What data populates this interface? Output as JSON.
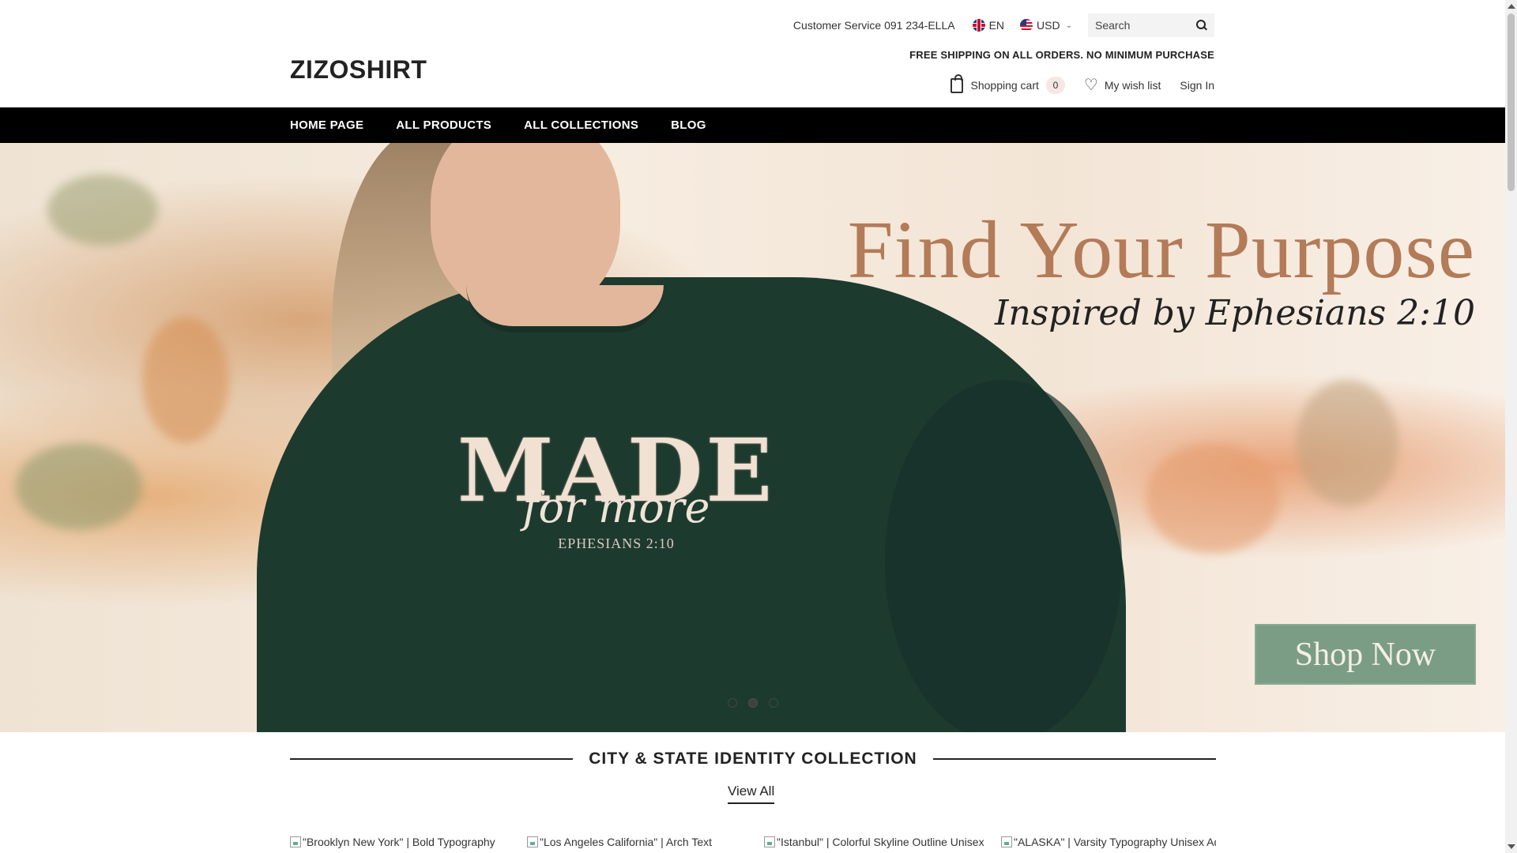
{
  "header": {
    "customer_service": "Customer Service 091 234-ELLA",
    "language": "EN",
    "currency": "USD",
    "search_placeholder": "Search",
    "promo": "FREE SHIPPING ON ALL ORDERS. NO MINIMUM PURCHASE",
    "logo": "ZIZOSHIRT",
    "cart_label": "Shopping cart",
    "cart_count": "0",
    "wishlist_label": "My wish list",
    "signin_label": "Sign In"
  },
  "nav": {
    "items": [
      {
        "label": "HOME PAGE"
      },
      {
        "label": "ALL PRODUCTS"
      },
      {
        "label": "ALL COLLECTIONS"
      },
      {
        "label": "BLOG"
      }
    ]
  },
  "hero": {
    "title": "Find Your Purpose",
    "subtitle": "Inspired by Ephesians 2:10",
    "shirt_print_main": "MADE",
    "shirt_print_script": "for more",
    "shirt_print_ref": "EPHESIANS 2:10",
    "cta_label": "Shop Now",
    "slides_total": 3,
    "active_slide": 2
  },
  "collection": {
    "title": "CITY & STATE IDENTITY COLLECTION",
    "view_all": "View All",
    "products": [
      {
        "alt": "\"Brooklyn New York\" | Bold Typography"
      },
      {
        "alt": "\"Los Angeles California\" | Arch Text"
      },
      {
        "alt": "\"Istanbul\" | Colorful Skyline Outline Unisex"
      },
      {
        "alt": "\"ALASKA\" | Varsity Typography Unisex Adult"
      }
    ]
  },
  "colors": {
    "nav_bg": "#000000",
    "title_color": "#b37b58",
    "cta_bg": "#7b9d86",
    "shirt": "#1d3a2f"
  }
}
